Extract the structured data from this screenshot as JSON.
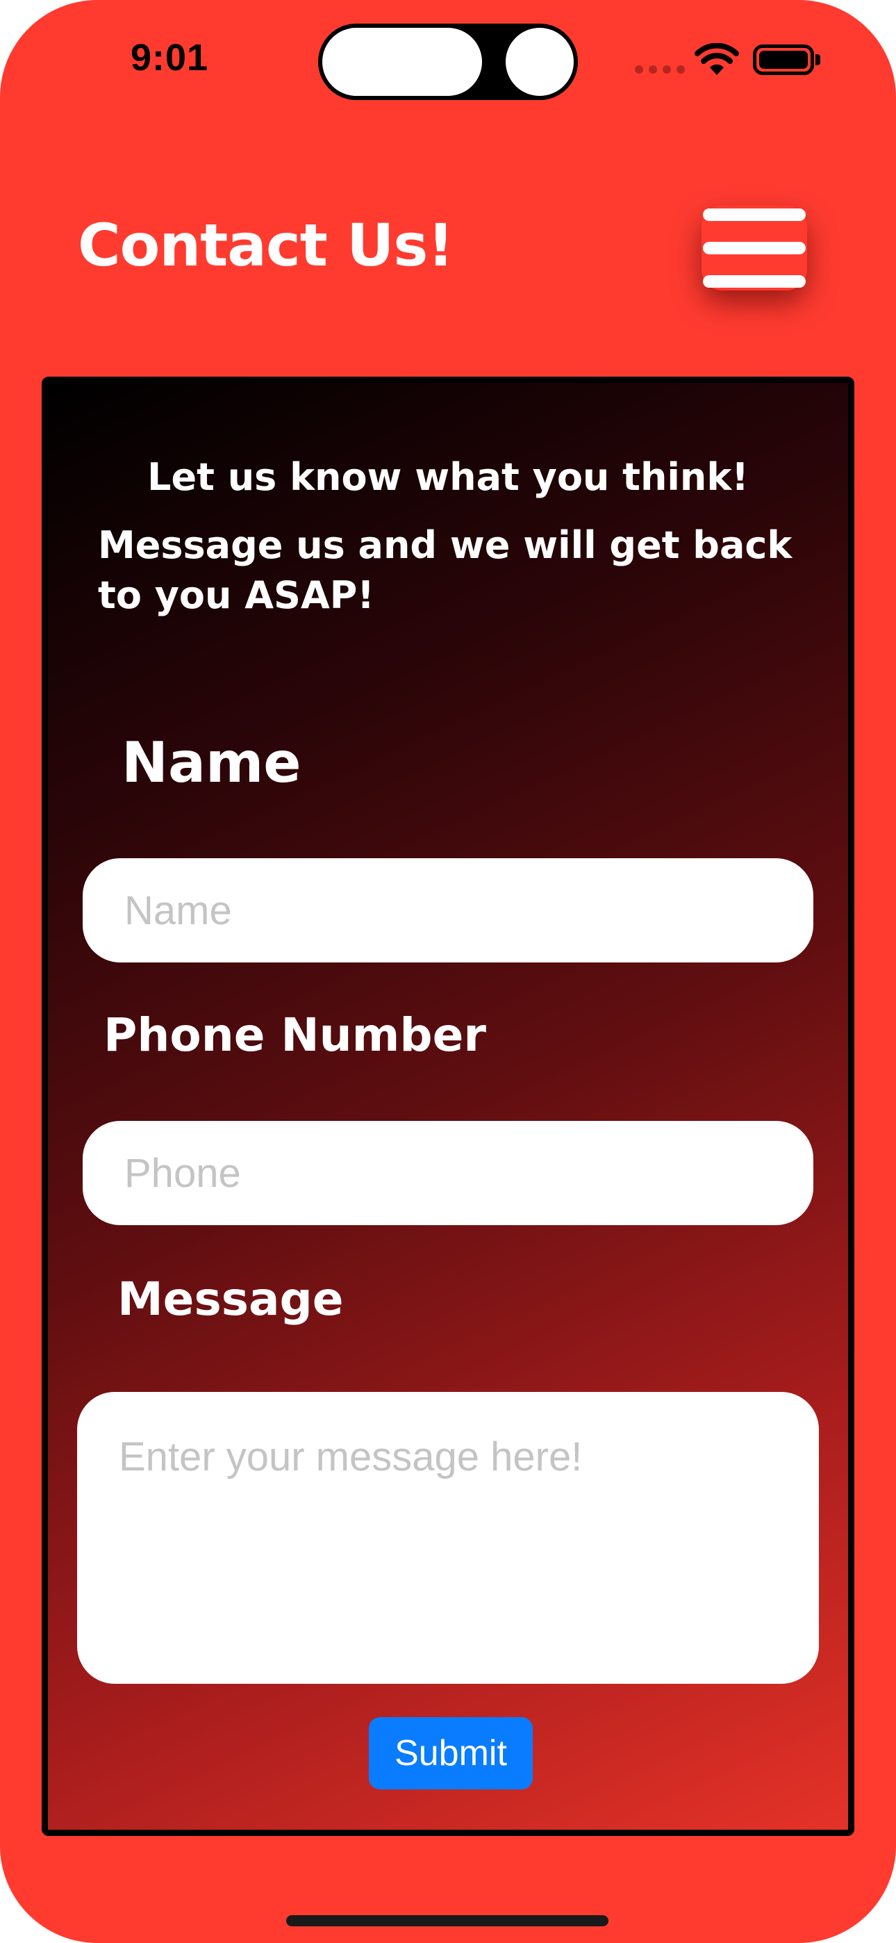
{
  "status_bar": {
    "time": "9:01",
    "icons": [
      "cellular-icon",
      "wifi-icon",
      "battery-icon"
    ]
  },
  "header": {
    "title": "Contact Us!",
    "menu_icon": "hamburger-menu-icon"
  },
  "card": {
    "heading": "Let us know what you think!",
    "subheading": "Message us and we will get back to you ASAP!"
  },
  "form": {
    "name_label": "Name",
    "name_placeholder": "Name",
    "phone_label": "Phone Number",
    "phone_placeholder": "Phone",
    "message_label": "Message",
    "message_placeholder": "Enter your message here!",
    "submit_label": "Submit"
  },
  "colors": {
    "background": "#ff3b30",
    "submit_button": "#0a7cff",
    "card_gradient_start": "#000000",
    "card_gradient_end": "#e53228"
  }
}
